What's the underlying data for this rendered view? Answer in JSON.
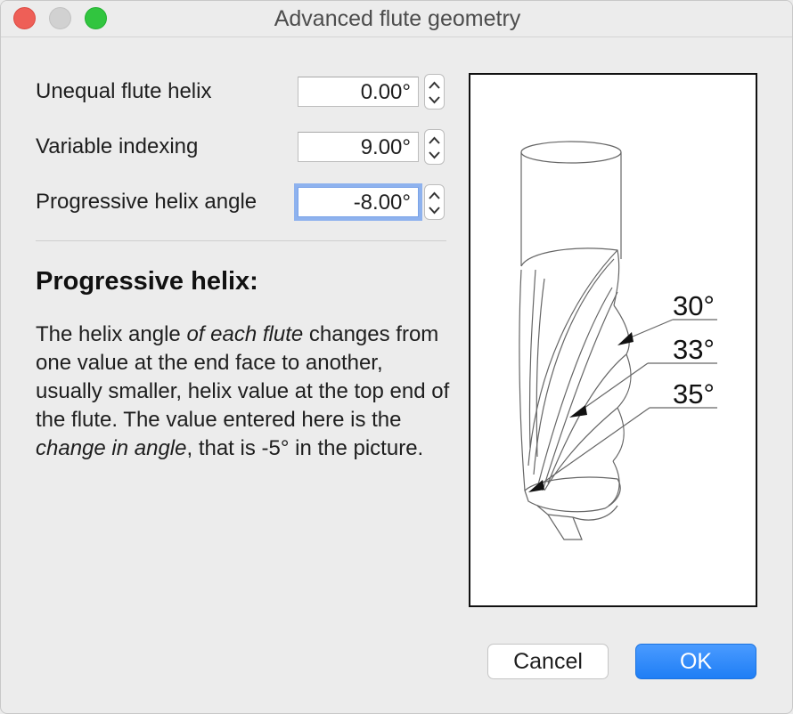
{
  "window": {
    "title": "Advanced flute geometry",
    "controls": [
      "close-button",
      "minimize-button",
      "maximize-button"
    ]
  },
  "fields": [
    {
      "label": "Unequal flute helix",
      "value": "0.00°"
    },
    {
      "label": "Variable indexing",
      "value": "9.00°"
    },
    {
      "label": "Progressive helix angle",
      "value": "-8.00°",
      "focused": true
    }
  ],
  "help": {
    "title": "Progressive helix:",
    "text_parts": [
      "The helix angle ",
      "of each flute",
      " changes from one value at the end face to another, usually smaller, helix value at the top end of the flute. The value entered here is the ",
      "change in angle",
      ", that is -5° in the picture."
    ]
  },
  "picture": {
    "angle_labels": [
      "30°",
      "33°",
      "35°"
    ]
  },
  "buttons": {
    "cancel": "Cancel",
    "ok": "OK"
  },
  "colors": {
    "accent": "#1f7ef5",
    "focus_ring": "#8eb2ee",
    "close": "#ee5f57",
    "maximize": "#31c53f"
  }
}
